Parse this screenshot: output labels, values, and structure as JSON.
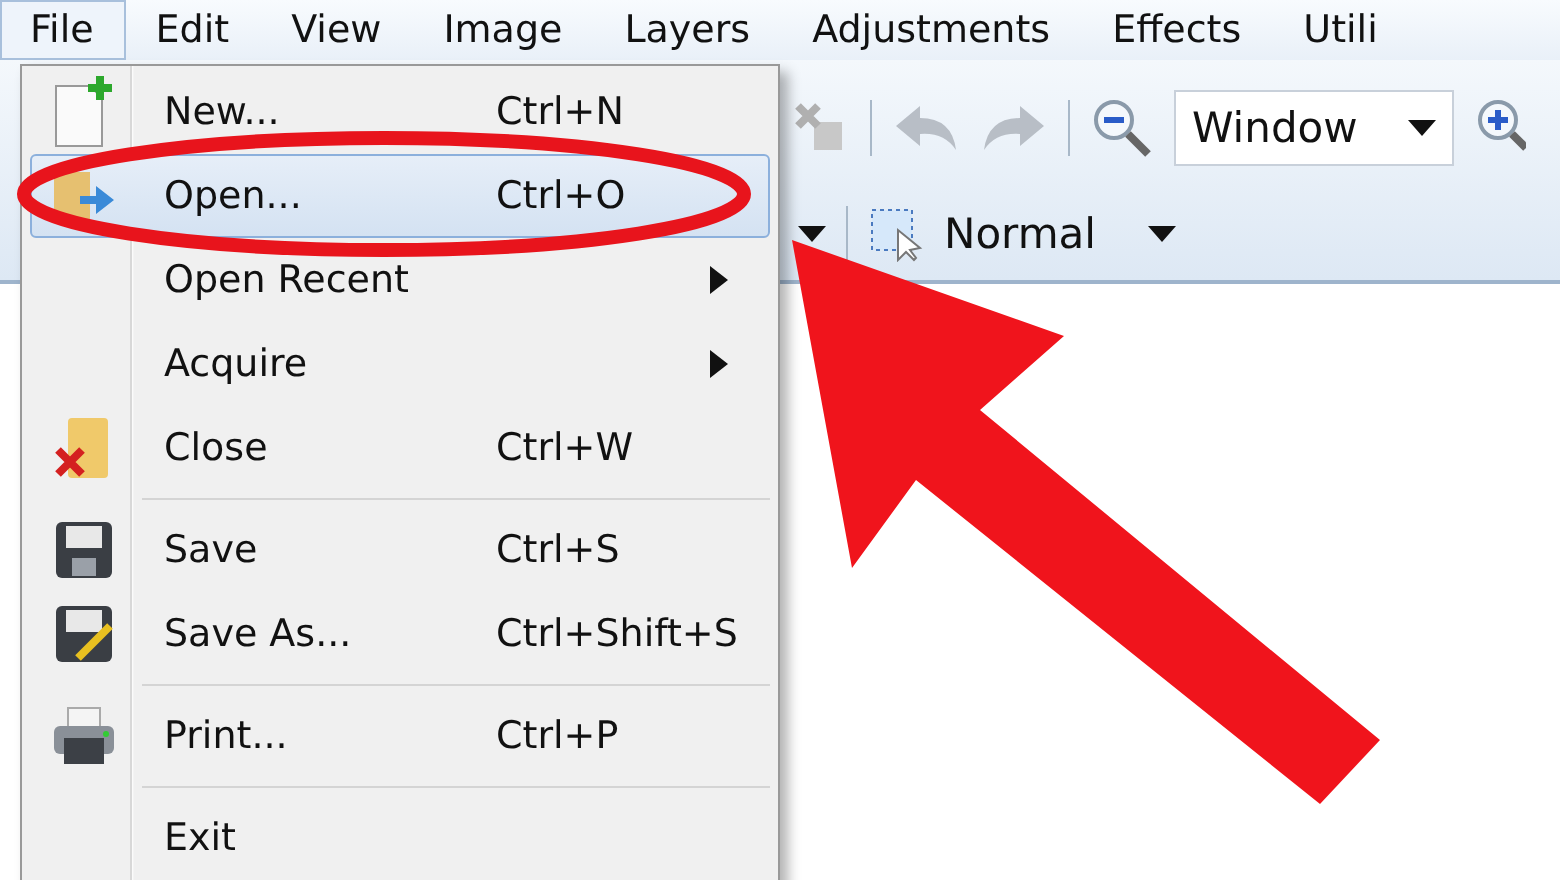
{
  "menubar": [
    {
      "label": "File",
      "selected": true
    },
    {
      "label": "Edit",
      "selected": false
    },
    {
      "label": "View",
      "selected": false
    },
    {
      "label": "Image",
      "selected": false
    },
    {
      "label": "Layers",
      "selected": false
    },
    {
      "label": "Adjustments",
      "selected": false
    },
    {
      "label": "Effects",
      "selected": false
    },
    {
      "label": "Utili",
      "selected": false
    }
  ],
  "toolbar": {
    "zoom_field": {
      "value": "Window"
    },
    "selection_mode": {
      "value": "Normal"
    }
  },
  "file_menu": [
    {
      "kind": "item",
      "label": "New...",
      "shortcut": "Ctrl+N",
      "submenu": false,
      "selected": false
    },
    {
      "kind": "item",
      "label": "Open...",
      "shortcut": "Ctrl+O",
      "submenu": false,
      "selected": true
    },
    {
      "kind": "item",
      "label": "Open Recent",
      "submenu": true,
      "selected": false
    },
    {
      "kind": "item",
      "label": "Acquire",
      "submenu": true,
      "selected": false
    },
    {
      "kind": "item",
      "label": "Close",
      "shortcut": "Ctrl+W",
      "submenu": false,
      "selected": false
    },
    {
      "kind": "separator"
    },
    {
      "kind": "item",
      "label": "Save",
      "shortcut": "Ctrl+S",
      "submenu": false,
      "selected": false
    },
    {
      "kind": "item",
      "label": "Save As...",
      "shortcut": "Ctrl+Shift+S",
      "submenu": false,
      "selected": false
    },
    {
      "kind": "separator"
    },
    {
      "kind": "item",
      "label": "Print...",
      "shortcut": "Ctrl+P",
      "submenu": false,
      "selected": false
    },
    {
      "kind": "separator"
    },
    {
      "kind": "item",
      "label": "Exit",
      "submenu": false,
      "selected": false
    }
  ]
}
